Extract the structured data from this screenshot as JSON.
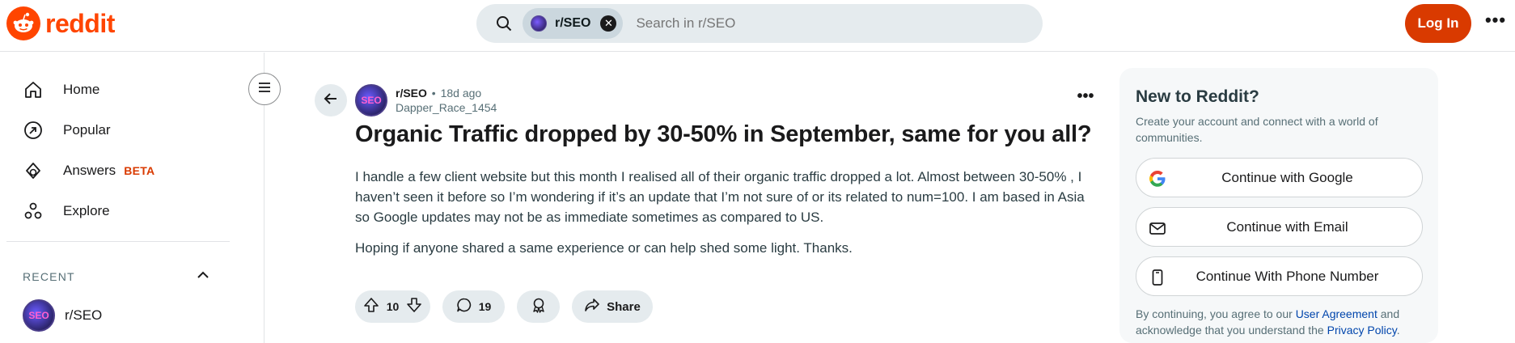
{
  "header": {
    "logo_text": "reddit",
    "search_chip": "r/SEO",
    "search_placeholder": "Search in r/SEO",
    "login_label": "Log In",
    "more_label": "•••"
  },
  "sidebar": {
    "items": [
      {
        "label": "Home",
        "icon": "home-icon"
      },
      {
        "label": "Popular",
        "icon": "popular-icon"
      },
      {
        "label": "Answers",
        "icon": "answers-icon",
        "badge": "BETA"
      },
      {
        "label": "Explore",
        "icon": "explore-icon"
      }
    ],
    "recent_title": "RECENT",
    "recent_items": [
      {
        "label": "r/SEO",
        "avatar_text": "SEO"
      }
    ]
  },
  "post": {
    "subreddit": "r/SEO",
    "separator": "•",
    "time": "18d ago",
    "author": "Dapper_Race_1454",
    "avatar_text": "SEO",
    "title": "Organic Traffic dropped by 30-50% in September, same for you all?",
    "body": [
      "I handle a few client website but this month I realised all of their organic traffic dropped a lot. Almost between 30-50% , I haven’t seen it before so I’m wondering if it’s an update that I’m not sure of or its related to num=100. I am based in Asia so Google updates may not be as immediate sometimes as compared to US.",
      "Hoping if anyone shared a same experience or can help shed some light. Thanks."
    ],
    "votes": "10",
    "comments": "19",
    "share_label": "Share",
    "more_label": "•••"
  },
  "signup": {
    "title": "New to Reddit?",
    "description": "Create your account and connect with a world of communities.",
    "google_label": "Continue with Google",
    "email_label": "Continue with Email",
    "phone_label": "Continue With Phone Number",
    "legal_prefix": "By continuing, you agree to our ",
    "legal_link1": "User Agreement",
    "legal_mid": " and acknowledge that you understand the ",
    "legal_link2": "Privacy Policy",
    "legal_suffix": "."
  },
  "colors": {
    "brand": "#ff4500",
    "login_button": "#d93a00",
    "beta_badge": "#d93a00",
    "link": "#0045ac",
    "pill_bg": "#e5ebee"
  }
}
